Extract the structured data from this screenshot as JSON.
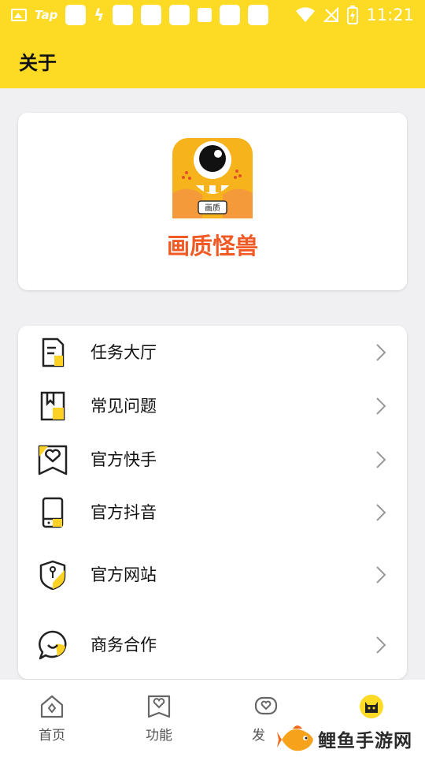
{
  "status_bar": {
    "carrier_text": "Tap",
    "time": "11:21"
  },
  "header": {
    "title": "关于"
  },
  "app": {
    "icon_text": "画质",
    "name": "画质怪兽"
  },
  "menu": {
    "items": [
      {
        "label": "任务大厅",
        "icon": "task-hall-icon"
      },
      {
        "label": "常见问题",
        "icon": "faq-book-icon"
      },
      {
        "label": "官方快手",
        "icon": "kuaishou-icon"
      },
      {
        "label": "官方抖音",
        "icon": "douyin-phone-icon"
      },
      {
        "label": "官方网站",
        "icon": "website-shield-icon"
      },
      {
        "label": "商务合作",
        "icon": "business-chat-icon"
      }
    ]
  },
  "bottom_nav": {
    "items": [
      {
        "label": "首页",
        "icon": "home-icon"
      },
      {
        "label": "功能",
        "icon": "function-icon"
      },
      {
        "label": "发",
        "icon": "discover-icon"
      },
      {
        "label": "",
        "icon": "cat-face-icon"
      }
    ]
  },
  "watermark": {
    "text": "鲤鱼手游网"
  },
  "colors": {
    "brand_yellow": "#fddb25",
    "app_name_orange": "#f15a24",
    "icon_dark": "#222222"
  }
}
